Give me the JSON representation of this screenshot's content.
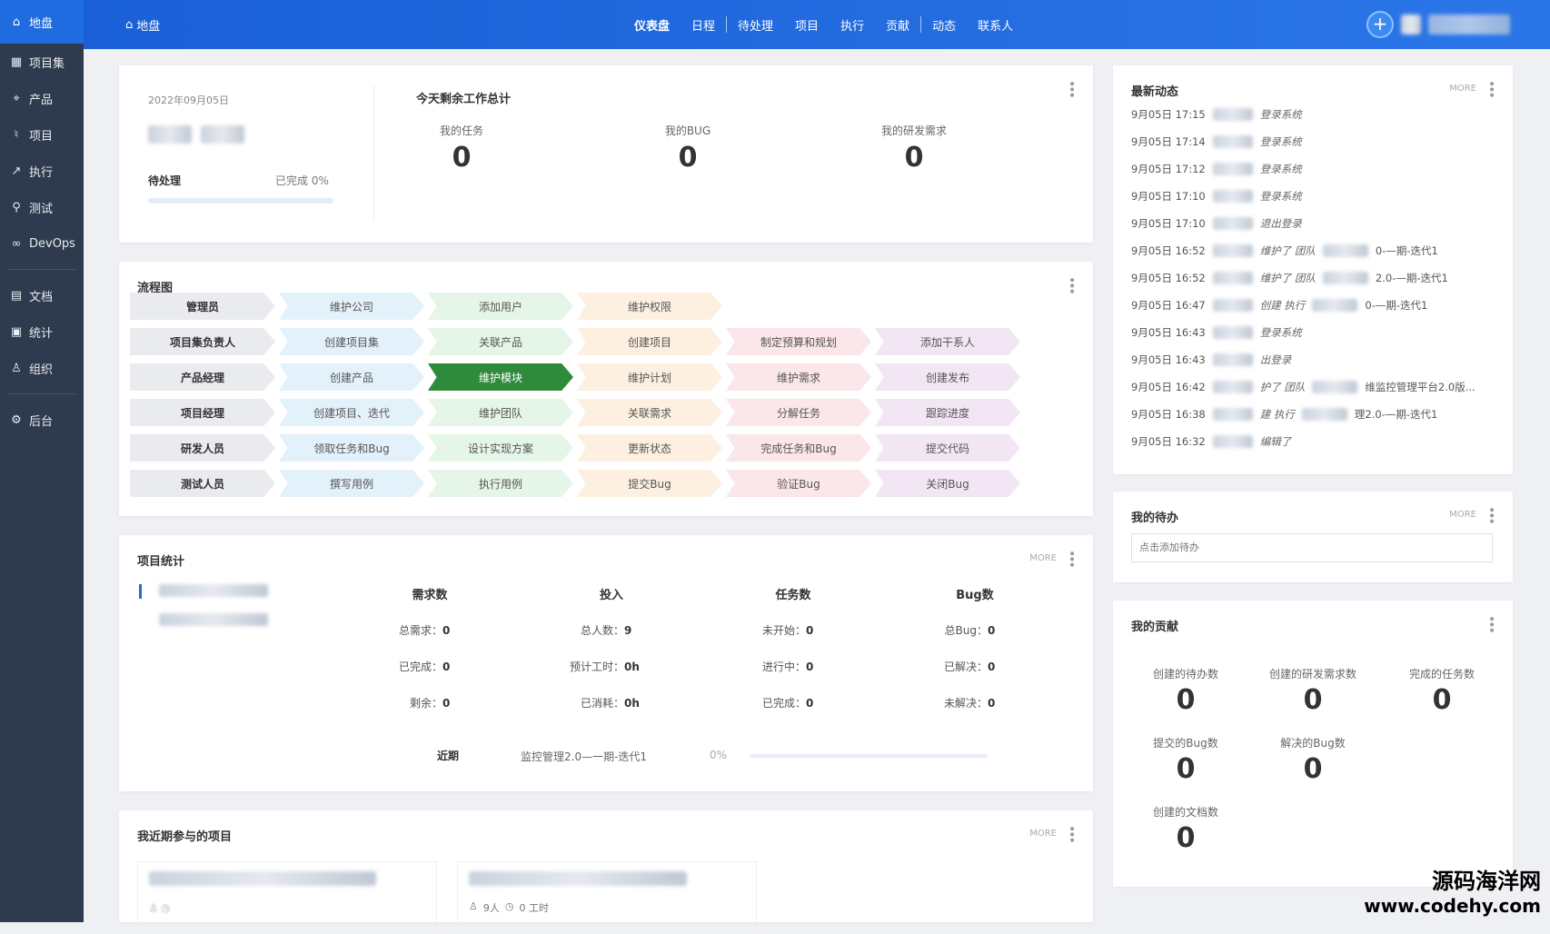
{
  "sidebar": {
    "items": [
      {
        "label": "地盘",
        "icon": "home-icon"
      },
      {
        "label": "项目集",
        "icon": "grid-icon"
      },
      {
        "label": "产品",
        "icon": "location-pin-icon"
      },
      {
        "label": "项目",
        "icon": "bell-icon"
      },
      {
        "label": "执行",
        "icon": "run-icon"
      },
      {
        "label": "测试",
        "icon": "search-icon"
      },
      {
        "label": "DevOps",
        "icon": "infinity-icon"
      },
      {
        "label": "文档",
        "icon": "document-icon"
      },
      {
        "label": "统计",
        "icon": "chart-icon"
      },
      {
        "label": "组织",
        "icon": "user-icon"
      },
      {
        "label": "后台",
        "icon": "gear-icon"
      }
    ]
  },
  "header": {
    "breadcrumb": "地盘",
    "nav": [
      "仪表盘",
      "日程",
      "待处理",
      "项目",
      "执行",
      "贡献",
      "动态",
      "联系人"
    ],
    "plus_label": "+"
  },
  "summary": {
    "date": "2022年09月05日",
    "pending_label": "待处理",
    "done_label": "已完成 0%",
    "title": "今天剩余工作总计",
    "stats": [
      {
        "label": "我的任务",
        "value": "0"
      },
      {
        "label": "我的BUG",
        "value": "0"
      },
      {
        "label": "我的研发需求",
        "value": "0"
      }
    ]
  },
  "flow": {
    "title": "流程图",
    "rows": [
      {
        "role": "管理员",
        "steps": [
          [
            "维护公司",
            "blue"
          ],
          [
            "添加用户",
            "green"
          ],
          [
            "维护权限",
            "orange"
          ]
        ]
      },
      {
        "role": "项目集负责人",
        "steps": [
          [
            "创建项目集",
            "blue"
          ],
          [
            "关联产品",
            "green"
          ],
          [
            "创建项目",
            "orange"
          ],
          [
            "制定预算和规划",
            "pink"
          ],
          [
            "添加干系人",
            "purple"
          ]
        ]
      },
      {
        "role": "产品经理",
        "steps": [
          [
            "创建产品",
            "blue"
          ],
          [
            "维护模块",
            "active"
          ],
          [
            "维护计划",
            "orange"
          ],
          [
            "维护需求",
            "pink"
          ],
          [
            "创建发布",
            "purple"
          ]
        ]
      },
      {
        "role": "项目经理",
        "steps": [
          [
            "创建项目、迭代",
            "blue"
          ],
          [
            "维护团队",
            "green"
          ],
          [
            "关联需求",
            "orange"
          ],
          [
            "分解任务",
            "pink"
          ],
          [
            "跟踪进度",
            "purple"
          ]
        ]
      },
      {
        "role": "研发人员",
        "steps": [
          [
            "领取任务和Bug",
            "blue"
          ],
          [
            "设计实现方案",
            "green"
          ],
          [
            "更新状态",
            "orange"
          ],
          [
            "完成任务和Bug",
            "pink"
          ],
          [
            "提交代码",
            "purple"
          ]
        ]
      },
      {
        "role": "测试人员",
        "steps": [
          [
            "撰写用例",
            "blue"
          ],
          [
            "执行用例",
            "green"
          ],
          [
            "提交Bug",
            "orange"
          ],
          [
            "验证Bug",
            "pink"
          ],
          [
            "关闭Bug",
            "purple"
          ]
        ]
      }
    ]
  },
  "project_stats": {
    "title": "项目统计",
    "more": "MORE",
    "columns": [
      {
        "head": "需求数",
        "items": [
          [
            "总需求：",
            "0"
          ],
          [
            "已完成：",
            "0"
          ],
          [
            "剩余：",
            "0"
          ]
        ]
      },
      {
        "head": "投入",
        "items": [
          [
            "总人数：",
            "9"
          ],
          [
            "预计工时：",
            "0h"
          ],
          [
            "已消耗：",
            "0h"
          ]
        ]
      },
      {
        "head": "任务数",
        "items": [
          [
            "未开始：",
            "0"
          ],
          [
            "进行中：",
            "0"
          ],
          [
            "已完成：",
            "0"
          ]
        ]
      },
      {
        "head": "Bug数",
        "items": [
          [
            "总Bug：",
            "0"
          ],
          [
            "已解决：",
            "0"
          ],
          [
            "未解决：",
            "0"
          ]
        ]
      }
    ],
    "recent_label": "近期",
    "recent_iteration": "监控管理2.0—一期-迭代1",
    "recent_percent": "0%"
  },
  "recent_projects": {
    "title": "我近期参与的项目",
    "more": "MORE",
    "items": [
      {
        "people": "",
        "hours": ""
      },
      {
        "people": "9人",
        "hours": "0 工时"
      }
    ]
  },
  "activity": {
    "title": "最新动态",
    "more": "MORE",
    "rows": [
      {
        "time": "9月05日 17:15",
        "text": "登录系统"
      },
      {
        "time": "9月05日 17:14",
        "text": "登录系统"
      },
      {
        "time": "9月05日 17:12",
        "text": "登录系统"
      },
      {
        "time": "9月05日 17:10",
        "text": "登录系统"
      },
      {
        "time": "9月05日 17:10",
        "text": "退出登录"
      },
      {
        "time": "9月05日 16:52",
        "text": "维护了 团队",
        "tail": "0-—期-迭代1"
      },
      {
        "time": "9月05日 16:52",
        "text": "维护了 团队",
        "tail": "2.0-—期-迭代1"
      },
      {
        "time": "9月05日 16:47",
        "text": "创建 执行",
        "tail": "0-—期-迭代1"
      },
      {
        "time": "9月05日 16:43",
        "text": "登录系统"
      },
      {
        "time": "9月05日 16:43",
        "text": "出登录"
      },
      {
        "time": "9月05日 16:42",
        "text": "护了 团队",
        "tail": "维监控管理平台2.0版..."
      },
      {
        "time": "9月05日 16:38",
        "text": "建 执行",
        "tail": "理2.0-—期-迭代1"
      },
      {
        "time": "9月05日 16:32",
        "text": "编辑了"
      }
    ]
  },
  "todo": {
    "title": "我的待办",
    "more": "MORE",
    "placeholder": "点击添加待办"
  },
  "contrib": {
    "title": "我的贡献",
    "stats": [
      {
        "label": "创建的待办数",
        "value": "0"
      },
      {
        "label": "创建的研发需求数",
        "value": "0"
      },
      {
        "label": "完成的任务数",
        "value": "0"
      },
      {
        "label": "提交的Bug数",
        "value": "0"
      },
      {
        "label": "解决的Bug数",
        "value": "0"
      },
      {
        "label": "创建的文档数",
        "value": "0"
      }
    ]
  },
  "watermark": {
    "line1": "源码海洋网",
    "line2": "www.codehy.com"
  }
}
